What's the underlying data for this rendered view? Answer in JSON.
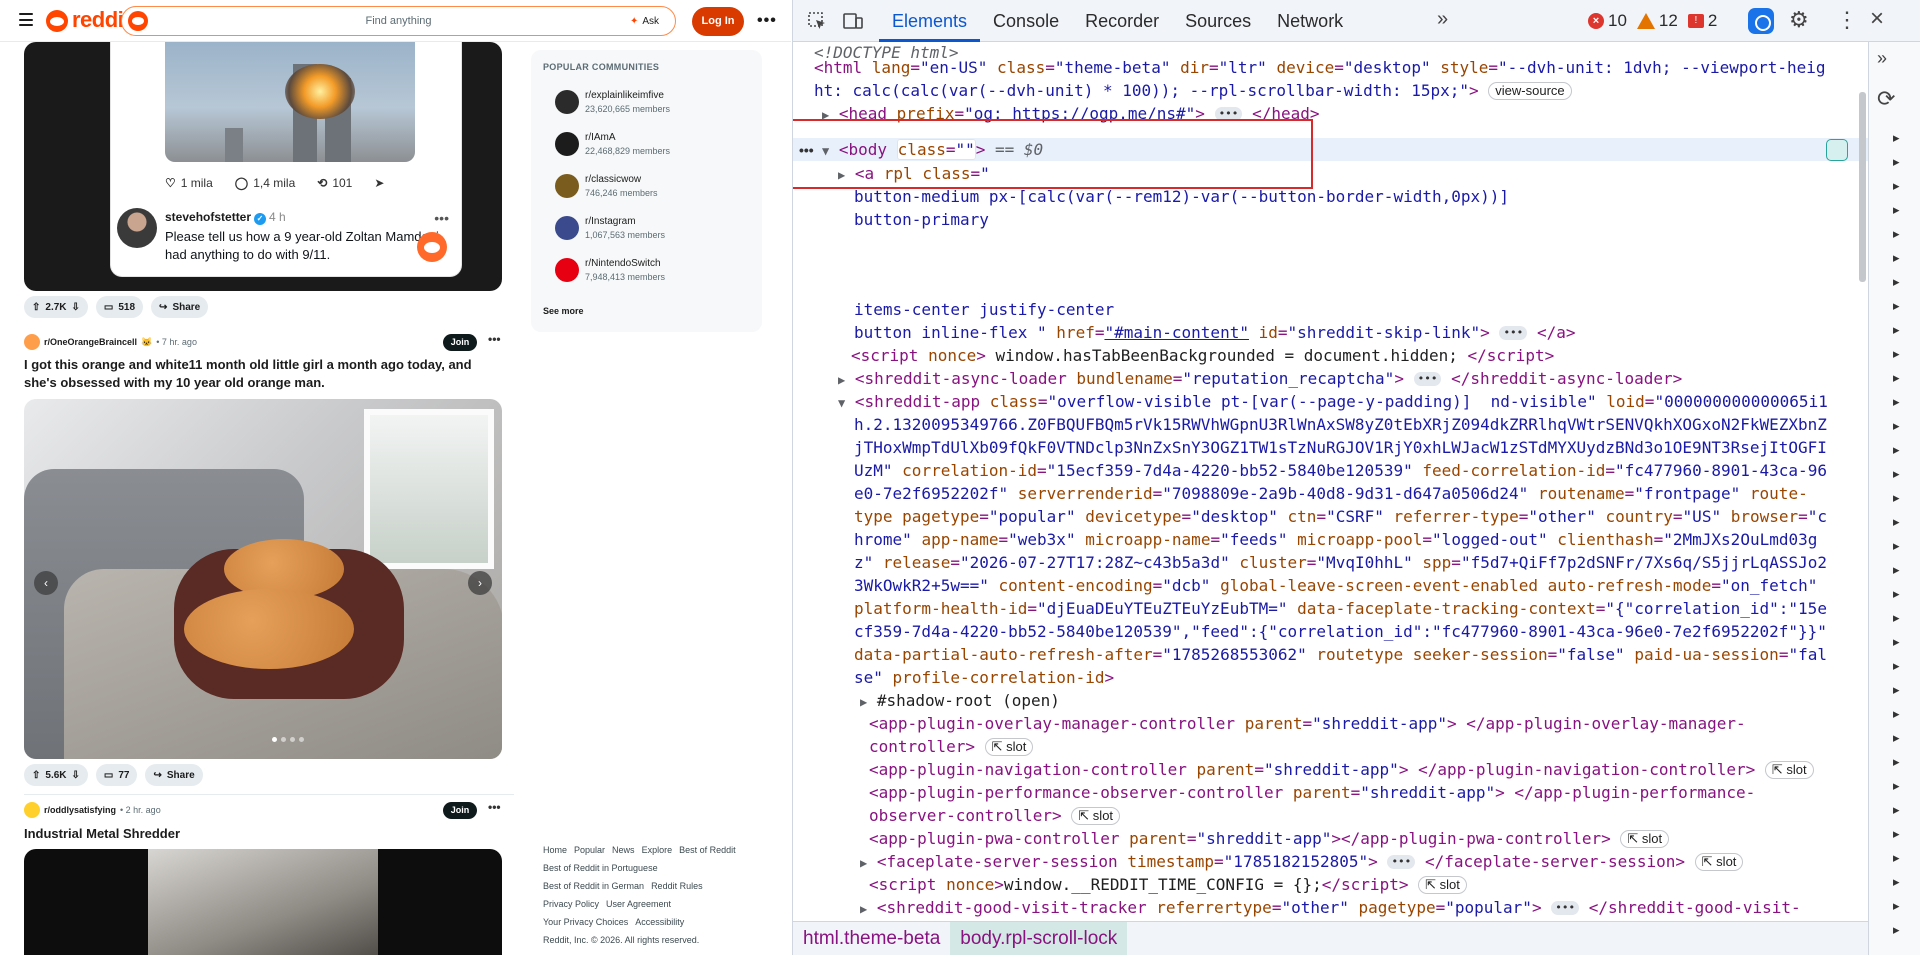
{
  "reddit": {
    "wordmark": "reddit",
    "search_placeholder": "Find anything",
    "ask_label": "Ask",
    "login_label": "Log In",
    "more": "•••",
    "post1": {
      "likes": "1 mila",
      "replies": "1,4 mila",
      "reposts": "101",
      "tweet_user": "stevehofstetter",
      "tweet_time": "4 h",
      "tweet_text": "Please tell us how a 9 year-old Zoltan Mamdani had anything to do with 9/11.",
      "votes": "2.7K",
      "comments": "518",
      "share": "Share"
    },
    "post2": {
      "sub": "r/OneOrangeBraincell",
      "time": "• 7 hr. ago",
      "join": "Join",
      "title": "I got this orange and white11 month old little girl a month ago today, and she's obsessed with my 10 year old orange man.",
      "votes": "5.6K",
      "comments": "77",
      "share": "Share"
    },
    "post3": {
      "sub": "r/oddlysatisfying",
      "time": "• 2 hr. ago",
      "join": "Join",
      "title": "Industrial Metal Shredder"
    },
    "popular": {
      "heading": "POPULAR COMMUNITIES",
      "items": [
        {
          "name": "r/explainlikeimfive",
          "members": "23,620,665 members",
          "color": "#2b2b2b"
        },
        {
          "name": "r/IAmA",
          "members": "22,468,829 members",
          "color": "#1c1c1c"
        },
        {
          "name": "r/classicwow",
          "members": "746,246 members",
          "color": "#7a5c1e"
        },
        {
          "name": "r/Instagram",
          "members": "1,067,563 members",
          "color": "#3a4a8c"
        },
        {
          "name": "r/NintendoSwitch",
          "members": "7,948,413 members",
          "color": "#e60012"
        }
      ],
      "see_more": "See more"
    },
    "footer": {
      "links1": [
        "Home",
        "Popular",
        "News",
        "Explore",
        "Best of Reddit"
      ],
      "links2": [
        "Best of Reddit in Portuguese"
      ],
      "links3": [
        "Best of Reddit in German",
        "Reddit Rules"
      ],
      "links4": [
        "Privacy Policy",
        "User Agreement"
      ],
      "links5": [
        "Your Privacy Choices",
        "Accessibility"
      ],
      "copyright": "Reddit, Inc. © 2026. All rights reserved."
    }
  },
  "devtools": {
    "tabs": [
      "Elements",
      "Console",
      "Recorder",
      "Sources",
      "Network"
    ],
    "errors": "10",
    "warnings": "12",
    "issues": "2",
    "crumbs": [
      "html.theme-beta",
      "body.rpl-scroll-lock"
    ]
  }
}
